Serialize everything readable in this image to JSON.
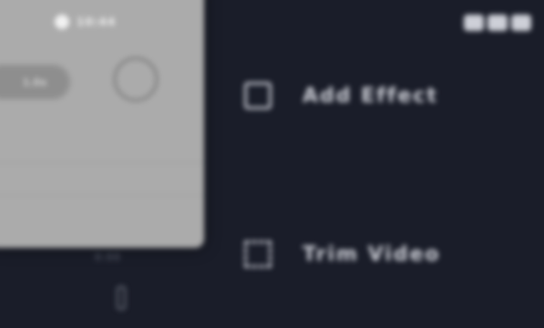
{
  "preview": {
    "status_text": "10:44",
    "pill_label": "1.0x",
    "caption": "0:00"
  },
  "menu": {
    "items": [
      {
        "label": "Add Effect",
        "icon": "effects-icon"
      },
      {
        "label": "Trim Video",
        "icon": "trim-icon"
      }
    ]
  },
  "colors": {
    "background": "#1a1d29",
    "card": "#ababab",
    "text": "#d0d2da"
  }
}
